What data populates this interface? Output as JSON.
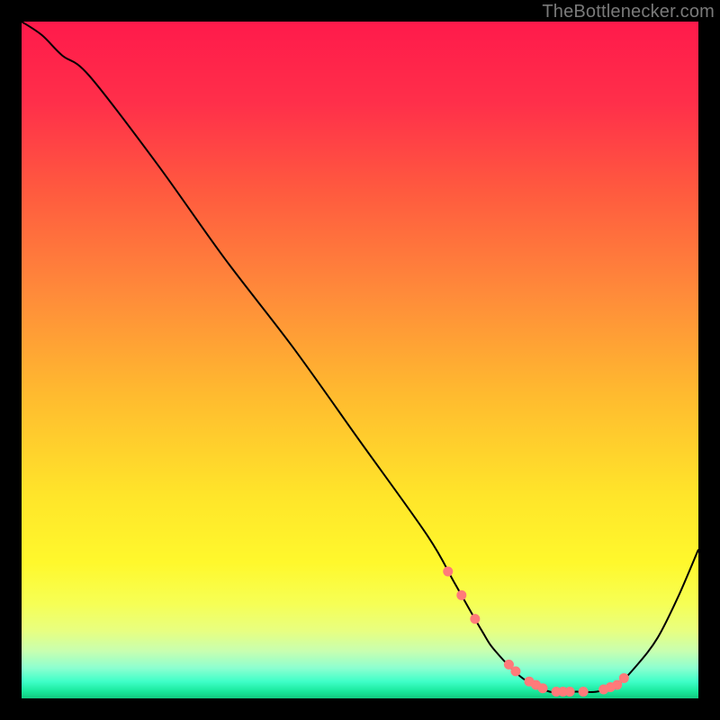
{
  "attribution": "TheBottlenecker.com",
  "colors": {
    "gradient_stops": [
      {
        "offset": 0.0,
        "color": "#ff1a4b"
      },
      {
        "offset": 0.12,
        "color": "#ff2f4a"
      },
      {
        "offset": 0.25,
        "color": "#ff5a3f"
      },
      {
        "offset": 0.4,
        "color": "#ff8a3a"
      },
      {
        "offset": 0.55,
        "color": "#ffba2f"
      },
      {
        "offset": 0.7,
        "color": "#ffe52a"
      },
      {
        "offset": 0.8,
        "color": "#fff82c"
      },
      {
        "offset": 0.86,
        "color": "#f6ff55"
      },
      {
        "offset": 0.9,
        "color": "#e8ff80"
      },
      {
        "offset": 0.93,
        "color": "#c8ffb0"
      },
      {
        "offset": 0.955,
        "color": "#8dffd0"
      },
      {
        "offset": 0.975,
        "color": "#3fffc8"
      },
      {
        "offset": 0.99,
        "color": "#18e89b"
      },
      {
        "offset": 1.0,
        "color": "#12c97f"
      }
    ],
    "curve": "#000000",
    "marker": "#ff7a7a"
  },
  "chart_data": {
    "type": "line",
    "title": "",
    "xlabel": "",
    "ylabel": "",
    "xlim": [
      0,
      100
    ],
    "ylim": [
      0,
      100
    ],
    "series": [
      {
        "name": "bottleneck-curve",
        "x": [
          0,
          3,
          6,
          10,
          20,
          30,
          40,
          50,
          60,
          64,
          68,
          70,
          74,
          78,
          82,
          85,
          88,
          91,
          94,
          97,
          100
        ],
        "y": [
          100,
          98,
          95,
          92,
          79,
          65,
          52,
          38,
          24,
          17,
          10,
          7,
          3,
          1,
          1,
          1,
          2,
          5,
          9,
          15,
          22
        ]
      }
    ],
    "markers": {
      "name": "highlight-points",
      "x": [
        63,
        65,
        67,
        72,
        73,
        75,
        76,
        77,
        79,
        80,
        81,
        83,
        86,
        87,
        88,
        89
      ],
      "y": [
        18,
        14,
        11,
        4,
        3,
        2,
        2,
        2,
        1,
        1,
        1,
        1,
        2,
        3,
        4,
        6
      ]
    }
  }
}
